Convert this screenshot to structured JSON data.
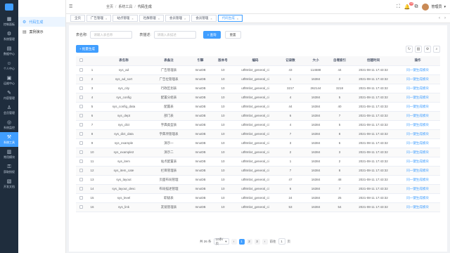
{
  "rail": {
    "items": [
      {
        "label": "控制面板",
        "icon": "dashboard-icon",
        "glyph": "▦"
      },
      {
        "label": "系统管理",
        "icon": "settings-icon",
        "glyph": "⚙"
      },
      {
        "label": "数据中心",
        "icon": "data-icon",
        "glyph": "▤"
      },
      {
        "label": "个人中心",
        "icon": "user-icon",
        "glyph": "☺"
      },
      {
        "label": "运维中心",
        "icon": "ops-icon",
        "glyph": "▣"
      },
      {
        "label": "内容管理",
        "icon": "content-icon",
        "glyph": "✎"
      },
      {
        "label": "会员管理",
        "icon": "member-icon",
        "glyph": "♙"
      },
      {
        "label": "系统监控",
        "icon": "monitor-icon",
        "glyph": "◎"
      },
      {
        "label": "系统工具",
        "icon": "tools-icon",
        "glyph": "⚒",
        "active": true
      },
      {
        "label": "常用模块",
        "icon": "module-icon",
        "glyph": "▥"
      },
      {
        "label": "获取授权",
        "icon": "license-icon",
        "glyph": "⚿"
      },
      {
        "label": "开发文档",
        "icon": "docs-icon",
        "glyph": "▧"
      }
    ]
  },
  "side2": {
    "items": [
      {
        "label": "代码生成",
        "glyph": "⚙",
        "active": true
      },
      {
        "label": "案例演示",
        "glyph": "▤"
      }
    ]
  },
  "breadcrumb": {
    "home": "全页",
    "parent": "系统工具",
    "current": "代码生成"
  },
  "header": {
    "notify_count": "13",
    "username": "管理员"
  },
  "tabs": [
    "全页",
    "广告管理",
    "站点管理",
    "社群管理",
    "会员管理",
    "会员管理",
    "代码生成"
  ],
  "search": {
    "table_name_label": "表名称:",
    "table_name_placeholder": "请输入表名称",
    "table_comment_label": "表描述:",
    "table_comment_placeholder": "请输入表描述",
    "search_btn": "查询",
    "reset_btn": "重置"
  },
  "toolbar": {
    "generate_btn": "批量生成"
  },
  "table": {
    "columns": [
      "",
      "",
      "表名称",
      "表备注",
      "引擎",
      "版本号",
      "编码",
      "记录数",
      "大小",
      "自增索引",
      "创建时间",
      "操作"
    ],
    "rows": [
      [
        "1",
        "sys_ad",
        "广告管理表",
        "InnoDB",
        "10",
        "utf8mb4_general_ci",
        "43",
        "114688",
        "44",
        "2021-08-11 17:43:32",
        "同一键生成模块"
      ],
      [
        "2",
        "sys_ad_sort",
        "广告位管理表",
        "InnoDB",
        "10",
        "utf8mb4_general_ci",
        "1",
        "16384",
        "2",
        "2021-08-11 17:43:32",
        "同一键生成模块"
      ],
      [
        "3",
        "sys_city",
        "行政区划表",
        "InnoDB",
        "10",
        "utf8mb4_general_ci",
        "3217",
        "262144",
        "3218",
        "2021-08-11 17:43:32",
        "同一键生成模块"
      ],
      [
        "4",
        "sys_config",
        "配置分组表",
        "InnoDB",
        "10",
        "utf8mb4_general_ci",
        "4",
        "16384",
        "5",
        "2021-08-11 17:43:32",
        "同一键生成模块"
      ],
      [
        "5",
        "sys_config_data",
        "配置表",
        "InnoDB",
        "10",
        "utf8mb4_general_ci",
        "44",
        "16384",
        "40",
        "2021-08-11 17:43:32",
        "同一键生成模块"
      ],
      [
        "6",
        "sys_dept",
        "部门表",
        "InnoDB",
        "10",
        "utf8mb4_general_ci",
        "6",
        "16384",
        "7",
        "2021-08-11 17:43:32",
        "同一键生成模块"
      ],
      [
        "7",
        "sys_dict",
        "字典类型表",
        "InnoDB",
        "10",
        "utf8mb4_general_ci",
        "4",
        "16384",
        "5",
        "2021-08-11 17:43:32",
        "同一键生成模块"
      ],
      [
        "8",
        "sys_dict_data",
        "字典项管理表",
        "InnoDB",
        "10",
        "utf8mb4_general_ci",
        "7",
        "16384",
        "8",
        "2021-08-11 17:43:32",
        "同一键生成模块"
      ],
      [
        "9",
        "sys_example",
        "演示一",
        "InnoDB",
        "10",
        "utf8mb4_general_ci",
        "3",
        "16384",
        "6",
        "2021-08-11 17:43:32",
        "同一键生成模块"
      ],
      [
        "10",
        "sys_example2",
        "演示二",
        "InnoDB",
        "10",
        "utf8mb4_general_ci",
        "2",
        "16384",
        "3",
        "2021-08-11 17:43:32",
        "同一键生成模块"
      ],
      [
        "11",
        "sys_item",
        "站点配置表",
        "InnoDB",
        "10",
        "utf8mb4_general_ci",
        "1",
        "16384",
        "2",
        "2021-08-11 17:43:32",
        "同一键生成模块"
      ],
      [
        "12",
        "sys_item_cate",
        "栏目管理表",
        "InnoDB",
        "10",
        "utf8mb4_general_ci",
        "7",
        "16384",
        "8",
        "2021-08-11 17:43:32",
        "同一键生成模块"
      ],
      [
        "13",
        "sys_layout",
        "页面布局管理",
        "InnoDB",
        "10",
        "utf8mb4_general_ci",
        "47",
        "16384",
        "48",
        "2021-08-11 17:43:32",
        "同一键生成模块"
      ],
      [
        "14",
        "sys_layout_desc",
        "布局描述管理",
        "InnoDB",
        "10",
        "utf8mb4_general_ci",
        "6",
        "16384",
        "7",
        "2021-08-11 17:43:32",
        "同一键生成模块"
      ],
      [
        "15",
        "sys_level",
        "职级表",
        "InnoDB",
        "10",
        "utf8mb4_general_ci",
        "24",
        "16384",
        "25",
        "2021-08-11 17:43:32",
        "同一键生成模块"
      ],
      [
        "16",
        "sys_link",
        "友链管理表",
        "InnoDB",
        "10",
        "utf8mb4_general_ci",
        "53",
        "16384",
        "54",
        "2021-08-11 17:43:32",
        "同一键生成模块"
      ]
    ]
  },
  "pagination": {
    "total": "共 26 条",
    "page_size": "10条/页",
    "pages": [
      "1",
      "2",
      "3"
    ],
    "jump_label": "前往",
    "jump_value": "1",
    "jump_suffix": "页"
  },
  "colors": {
    "primary": "#409eff",
    "rail": "#1f2d3d"
  }
}
